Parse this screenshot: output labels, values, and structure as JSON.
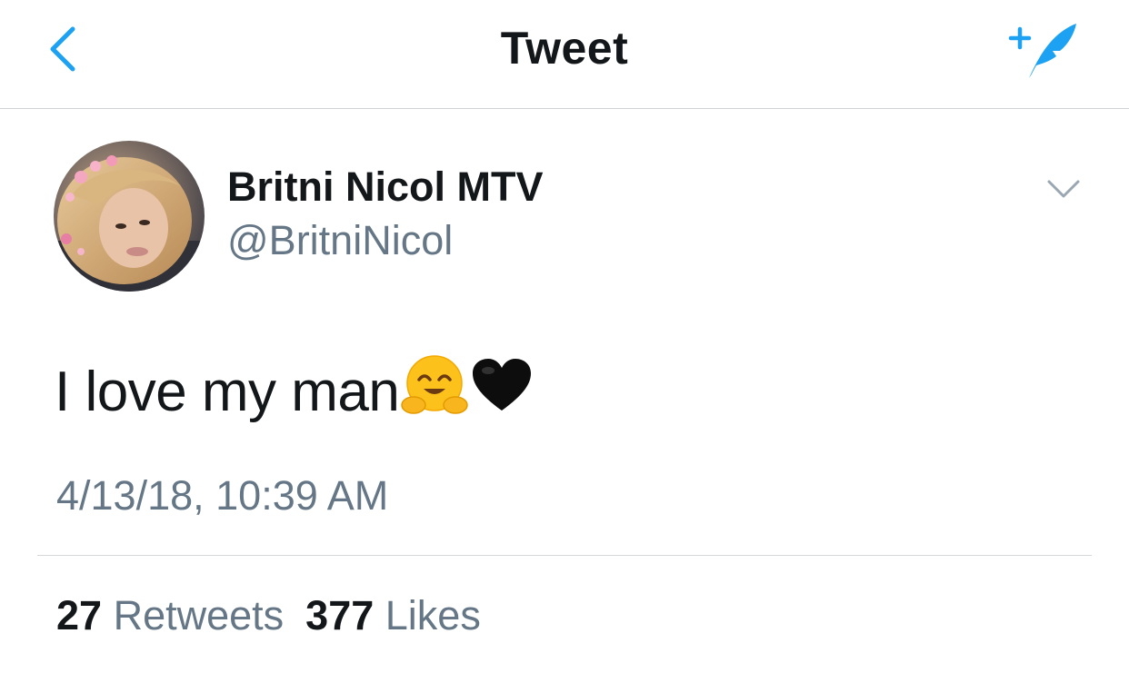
{
  "nav": {
    "title": "Tweet",
    "back_icon": "chevron-left-icon",
    "compose_icon": "compose-tweet-icon",
    "accent_color": "#1da1f2"
  },
  "tweet": {
    "author_name": "Britni Nicol MTV",
    "author_handle": "@BritniNicol",
    "text": "I love my man",
    "emojis": [
      "hugging-face-emoji",
      "black-heart-emoji"
    ],
    "timestamp": "4/13/18, 10:39 AM",
    "more_icon": "chevron-down-icon"
  },
  "stats": {
    "retweets_count": "27",
    "retweets_label": "Retweets",
    "likes_count": "377",
    "likes_label": "Likes"
  }
}
